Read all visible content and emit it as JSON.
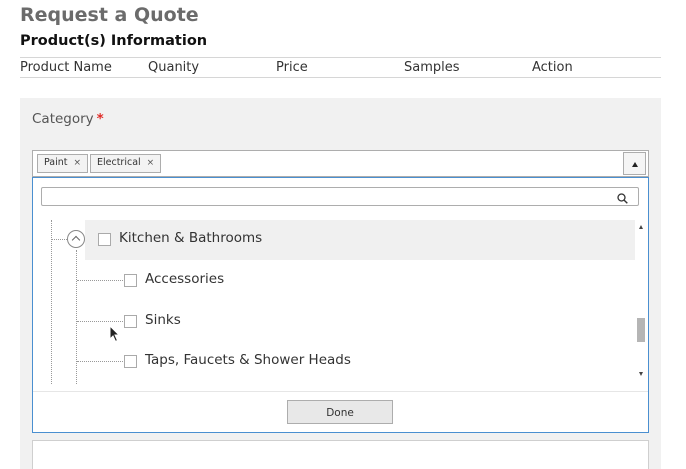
{
  "page": {
    "title": "Request a Quote",
    "section_title": "Product(s) Information"
  },
  "table": {
    "columns": [
      "Product Name",
      "Quanity",
      "Price",
      "Samples",
      "Action"
    ]
  },
  "category": {
    "label": "Category",
    "required_mark": "*",
    "selected_tags": [
      {
        "label": "Paint",
        "remove": "×"
      },
      {
        "label": "Electrical",
        "remove": "×"
      }
    ]
  },
  "dropdown": {
    "search_placeholder": "",
    "parent": {
      "label": "Kitchen & Bathrooms",
      "expanded": true
    },
    "children": [
      "Accessories",
      "Sinks",
      "Taps, Faucets & Shower Heads"
    ],
    "done_label": "Done"
  },
  "icons": {
    "search": "search-icon",
    "collapse": "chevron-up-circle-icon",
    "toggle": "triangle-up-icon",
    "cursor": "mouse-pointer-icon"
  },
  "colors": {
    "required": "#e02b27",
    "focus_border": "#4a8fd0",
    "panel_bg": "#f1f1f1"
  }
}
